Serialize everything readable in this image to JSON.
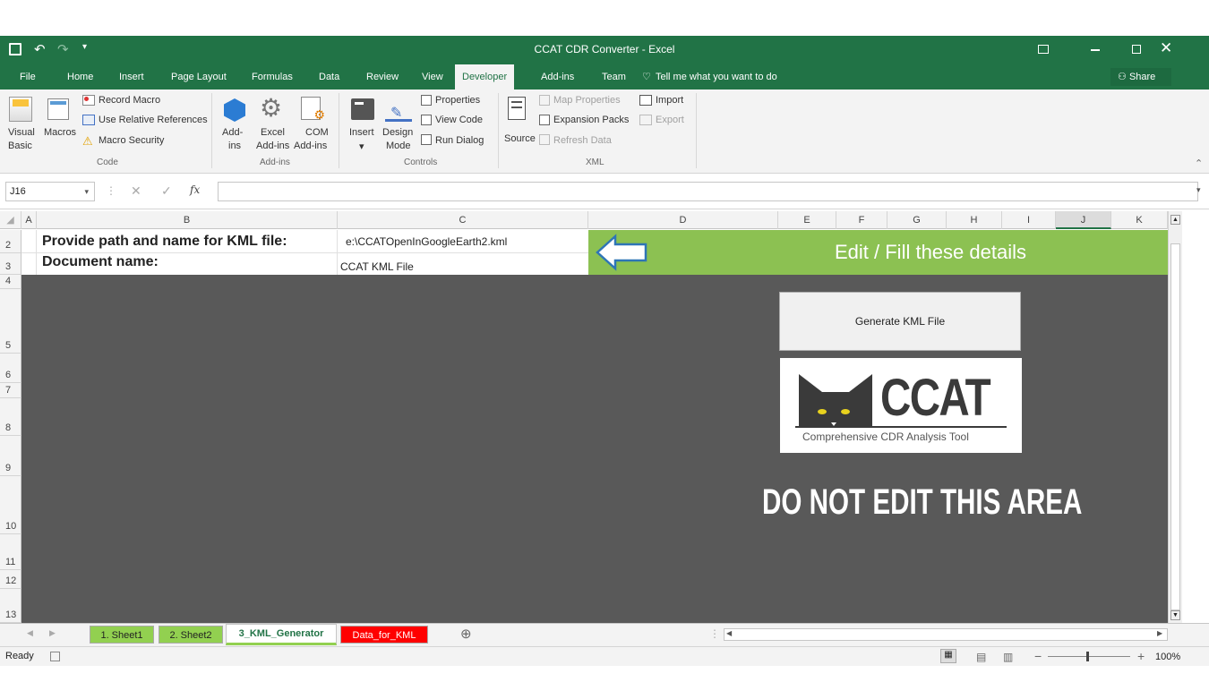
{
  "window": {
    "title": "CCAT CDR Converter - Excel"
  },
  "ribbon_tabs": [
    "File",
    "Home",
    "Insert",
    "Page Layout",
    "Formulas",
    "Data",
    "Review",
    "View",
    "Developer",
    "Add-ins",
    "Team"
  ],
  "active_tab": "Developer",
  "tell_me": "Tell me what you want to do",
  "share": "Share",
  "ribbon": {
    "code": {
      "visual_basic": [
        "Visual",
        "Basic"
      ],
      "macros": "Macros",
      "record_macro": "Record Macro",
      "relative_refs": "Use Relative References",
      "macro_security": "Macro Security",
      "group": "Code"
    },
    "addins": {
      "addins": [
        "Add-",
        "ins"
      ],
      "excel_addins": [
        "Excel",
        "Add-ins"
      ],
      "com_addins": [
        "COM",
        "Add-ins"
      ],
      "group": "Add-ins"
    },
    "controls": {
      "insert": "Insert",
      "design_mode": [
        "Design",
        "Mode"
      ],
      "properties": "Properties",
      "view_code": "View Code",
      "run_dialog": "Run Dialog",
      "group": "Controls"
    },
    "xml": {
      "source": "Source",
      "map_properties": "Map Properties",
      "expansion_packs": "Expansion Packs",
      "refresh_data": "Refresh Data",
      "import": "Import",
      "export": "Export",
      "group": "XML"
    }
  },
  "formula_bar": {
    "name_box": "J16",
    "fx": "fx",
    "content": ""
  },
  "columns": [
    "A",
    "B",
    "C",
    "D",
    "E",
    "F",
    "G",
    "H",
    "I",
    "J",
    "K"
  ],
  "rows": [
    "2",
    "3",
    "4",
    "5",
    "6",
    "7",
    "8",
    "9",
    "10",
    "11",
    "12",
    "13"
  ],
  "cells": {
    "b2": "Provide path and name for KML file:",
    "c2": "e:\\CCATOpenInGoogleEarth2.kml",
    "b3": "Document name:",
    "c3": "CCAT KML File",
    "banner": "Edit / Fill these details"
  },
  "generate_button": "Generate KML File",
  "logo": {
    "text": "CCAT",
    "subtitle": "Comprehensive CDR Analysis Tool"
  },
  "warning": "DO NOT EDIT THIS AREA",
  "sheet_tabs": [
    {
      "label": "1. Sheet1",
      "color": "#92d050"
    },
    {
      "label": "2. Sheet2",
      "color": "#92d050"
    },
    {
      "label": "3_KML_Generator",
      "color": "#ffffff"
    },
    {
      "label": "Data_for_KML",
      "color": "#ff0000"
    }
  ],
  "status": {
    "ready": "Ready",
    "zoom": "100%"
  },
  "colors": {
    "excel_green": "#217346",
    "banner_green": "#8cc152",
    "dark_area": "#595959"
  }
}
